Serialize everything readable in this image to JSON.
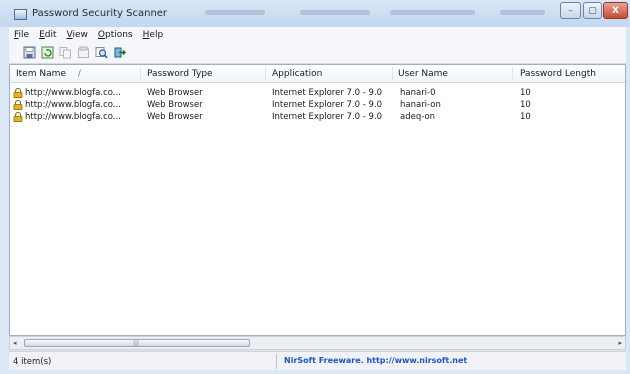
{
  "window": {
    "title": "Password Security Scanner",
    "buttons": {
      "minimize": "–",
      "maximize": "▢",
      "close": "X"
    }
  },
  "menu": [
    {
      "accel": "F",
      "rest": "ile"
    },
    {
      "accel": "E",
      "rest": "dit"
    },
    {
      "accel": "V",
      "rest": "iew"
    },
    {
      "accel": "O",
      "rest": "ptions"
    },
    {
      "accel": "H",
      "rest": "elp"
    }
  ],
  "toolbar": [
    {
      "name": "save-icon"
    },
    {
      "name": "refresh-icon"
    },
    {
      "name": "copy-icon"
    },
    {
      "name": "properties-icon"
    },
    {
      "name": "find-icon"
    },
    {
      "name": "exit-icon"
    }
  ],
  "columns": {
    "item_name": "Item Name",
    "sort_indicator": "/",
    "password_type": "Password Type",
    "application": "Application",
    "user_name": "User Name",
    "password_length": "Password Length"
  },
  "rows": [
    {
      "item_name": "http://www.blogfa.co...",
      "password_type": "Web Browser",
      "application": "Internet Explorer 7.0 - 9.0",
      "user_name": "hanari-0",
      "password_length": "10"
    },
    {
      "item_name": "http://www.blogfa.co...",
      "password_type": "Web Browser",
      "application": "Internet Explorer 7.0 - 9.0",
      "user_name": "hanari-on",
      "password_length": "10"
    },
    {
      "item_name": "http://www.blogfa.co...",
      "password_type": "Web Browser",
      "application": "Internet Explorer 7.0 - 9.0",
      "user_name": "adeq-on",
      "password_length": "10"
    }
  ],
  "scrollbar": {
    "left_arrow": "◂",
    "right_arrow": "▸",
    "grip": "|||"
  },
  "status": {
    "count": "4 item(s)",
    "link": "NirSoft Freeware.  http://www.nirsoft.net"
  },
  "colors": {
    "link": "#1e56c9",
    "lock": "#e2b51c"
  }
}
